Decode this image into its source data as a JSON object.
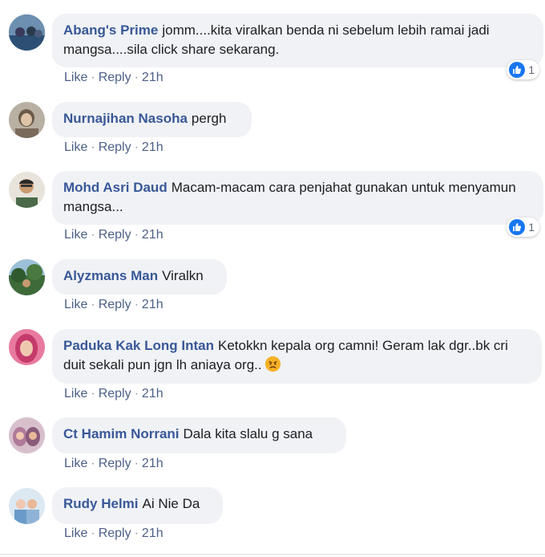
{
  "comments": [
    {
      "author": "Abang's Prime",
      "text": "jomm....kita viralkan benda ni sebelum lebih ramai jadi mangsa....sila click share sekarang.",
      "like": "Like",
      "reply": "Reply",
      "time": "21h",
      "reaction_count": "1",
      "avatar_color": "#3b6a8c"
    },
    {
      "author": "Nurnajihan Nasoha",
      "text": "pergh",
      "like": "Like",
      "reply": "Reply",
      "time": "21h",
      "avatar_color": "#8a7a6a"
    },
    {
      "author": "Mohd Asri Daud",
      "text": "Macam-macam cara penjahat gunakan untuk menyamun mangsa...",
      "like": "Like",
      "reply": "Reply",
      "time": "21h",
      "reaction_count": "1",
      "avatar_color": "#d8d2c4"
    },
    {
      "author": "Alyzmans Man",
      "text": "Viralkn",
      "like": "Like",
      "reply": "Reply",
      "time": "21h",
      "avatar_color": "#4f7a4a"
    },
    {
      "author": "Paduka Kak Long Intan",
      "text": "Ketokkn kepala org camni! Geram lak dgr..bk cri duit sekali pun jgn lh aniaya org..",
      "like": "Like",
      "reply": "Reply",
      "time": "21h",
      "avatar_color": "#c43a6a"
    },
    {
      "author": "Ct Hamim Norrani",
      "text": "Dala kita slalu g sana",
      "like": "Like",
      "reply": "Reply",
      "time": "21h",
      "avatar_color": "#b58aa6"
    },
    {
      "author": "Rudy Helmi",
      "text": "Ai Nie Da",
      "like": "Like",
      "reply": "Reply",
      "time": "21h",
      "avatar_color": "#8fb3d6"
    }
  ],
  "icons": {
    "reaction": "thumbs-up-icon",
    "emoji": "angry-face-icon"
  },
  "colors": {
    "author": "#385898",
    "bubble": "#f0f2f5",
    "like_blue": "#1877f2"
  }
}
